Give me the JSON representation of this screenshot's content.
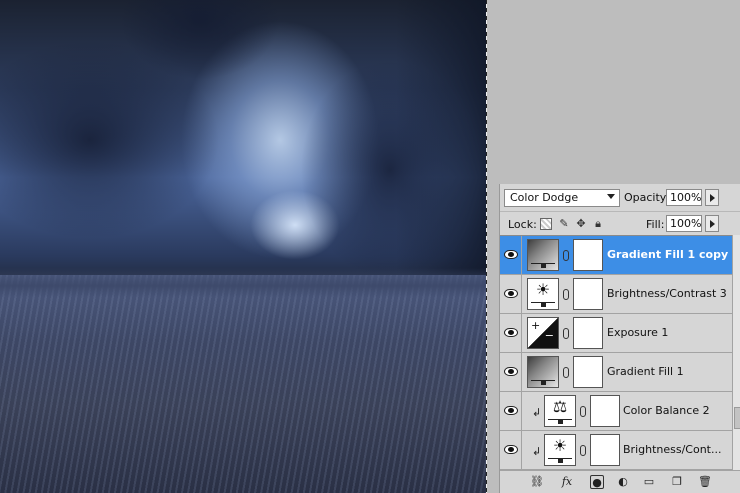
{
  "layers_panel": {
    "blend_mode": "Color Dodge",
    "opacity_label": "Opacity:",
    "opacity_value": "100%",
    "lock_label": "Lock:",
    "fill_label": "Fill:",
    "fill_value": "100%",
    "layers": [
      {
        "name": "Gradient Fill 1 copy",
        "thumb": "gradient-fill-icon",
        "selected": true,
        "clipped": false
      },
      {
        "name": "Brightness/Contrast 3",
        "thumb": "brightness-contrast-icon",
        "selected": false,
        "clipped": false
      },
      {
        "name": "Exposure 1",
        "thumb": "exposure-icon",
        "selected": false,
        "clipped": false
      },
      {
        "name": "Gradient Fill 1",
        "thumb": "gradient-fill-icon",
        "selected": false,
        "clipped": false
      },
      {
        "name": "Color Balance 2",
        "thumb": "color-balance-icon",
        "selected": false,
        "clipped": true
      },
      {
        "name": "Brightness/Cont...",
        "thumb": "brightness-contrast-icon",
        "selected": false,
        "clipped": true
      }
    ],
    "selection_color": "#3d8ee6"
  }
}
